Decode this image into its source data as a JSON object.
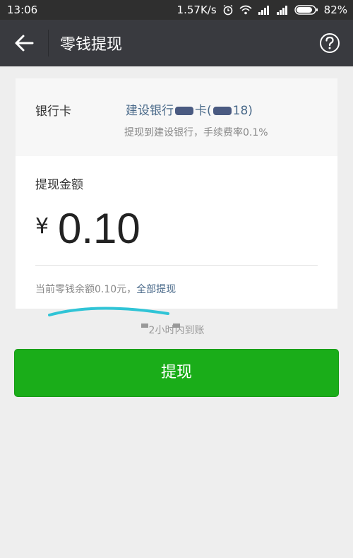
{
  "status_bar": {
    "time": "13:06",
    "network_speed": "1.57K/s",
    "battery": "82%"
  },
  "nav": {
    "title": "零钱提现",
    "back_icon": "arrow-left-icon",
    "help_icon": "question-circle-icon"
  },
  "bank": {
    "label": "银行卡",
    "name_prefix": "建设银行",
    "name_mid": "卡(",
    "name_suffix": "18)",
    "note": "提现到建设银行，手续费率0.1%"
  },
  "amount": {
    "label": "提现金额",
    "currency": "¥",
    "value": "0.10",
    "balance_text": "当前零钱余额0.10元，",
    "withdraw_all": "全部提现"
  },
  "arrival_note": "2小时内到账",
  "button": {
    "label": "提现"
  },
  "colors": {
    "nav_bg": "#393a3f",
    "button_green": "#1aad19",
    "link": "#4a6a8a",
    "annotation": "#30c4d6"
  }
}
